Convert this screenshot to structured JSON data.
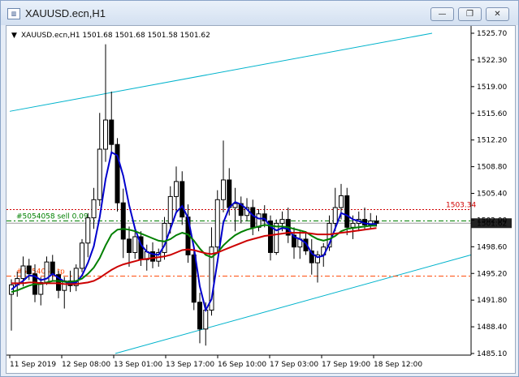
{
  "window": {
    "title": "XAUUSD.ecn,H1",
    "minimize_glyph": "—",
    "restore_glyph": "❐",
    "close_glyph": "✕"
  },
  "chart_info": {
    "header": "XAUUSD.ecn,H1  1501.68 1501.68 1501.58 1501.62"
  },
  "chart_data": {
    "type": "candlestick",
    "symbol": "XAUUSD.ecn",
    "timeframe": "H1",
    "ohlc_header": [
      1501.68,
      1501.68,
      1501.58,
      1501.62
    ],
    "y_ticks": [
      "1525.70",
      "1522.30",
      "1519.00",
      "1515.60",
      "1512.20",
      "1508.80",
      "1505.40",
      "1502.00",
      "1498.60",
      "1495.20",
      "1491.80",
      "1488.40",
      "1485.10"
    ],
    "x_ticks": [
      "11 Sep 2019",
      "12 Sep 08:00",
      "13 Sep 01:00",
      "13 Sep 17:00",
      "16 Sep 10:00",
      "17 Sep 03:00",
      "17 Sep 19:00",
      "18 Sep 12:00"
    ],
    "ylim": [
      1485.1,
      1525.7
    ],
    "current_price": "1501.62",
    "order_levels": [
      {
        "label": "#5054058 sell 0.09",
        "price": 1501.9,
        "color": "#008000"
      },
      {
        "label": "#5054058 tp",
        "price": 1494.9,
        "color": "#ff4500"
      }
    ],
    "stop_line": {
      "label": "1503.34",
      "price": 1503.34,
      "color": "#d00000"
    },
    "candles": [
      {
        "o": 1492.6,
        "h": 1494.5,
        "l": 1488.0,
        "c": 1493.8
      },
      {
        "o": 1493.8,
        "h": 1495.5,
        "l": 1492.3,
        "c": 1494.6
      },
      {
        "o": 1494.6,
        "h": 1497.4,
        "l": 1493.6,
        "c": 1496.2
      },
      {
        "o": 1496.2,
        "h": 1497.1,
        "l": 1494.4,
        "c": 1495.2
      },
      {
        "o": 1495.2,
        "h": 1496.4,
        "l": 1491.6,
        "c": 1492.6
      },
      {
        "o": 1492.6,
        "h": 1494.8,
        "l": 1491.2,
        "c": 1494.1
      },
      {
        "o": 1494.1,
        "h": 1497.4,
        "l": 1493.8,
        "c": 1496.7
      },
      {
        "o": 1496.7,
        "h": 1497.6,
        "l": 1494.4,
        "c": 1495.1
      },
      {
        "o": 1495.1,
        "h": 1495.6,
        "l": 1492.1,
        "c": 1493.1
      },
      {
        "o": 1493.1,
        "h": 1494.8,
        "l": 1490.8,
        "c": 1494.3
      },
      {
        "o": 1494.3,
        "h": 1495.6,
        "l": 1492.9,
        "c": 1493.7
      },
      {
        "o": 1493.7,
        "h": 1496.4,
        "l": 1493.0,
        "c": 1495.9
      },
      {
        "o": 1495.9,
        "h": 1499.6,
        "l": 1495.4,
        "c": 1499.1
      },
      {
        "o": 1499.1,
        "h": 1502.9,
        "l": 1497.3,
        "c": 1502.3
      },
      {
        "o": 1502.3,
        "h": 1506.1,
        "l": 1500.9,
        "c": 1504.6
      },
      {
        "o": 1504.6,
        "h": 1515.6,
        "l": 1503.8,
        "c": 1511.0
      },
      {
        "o": 1511.0,
        "h": 1524.3,
        "l": 1509.4,
        "c": 1514.7
      },
      {
        "o": 1514.7,
        "h": 1518.3,
        "l": 1510.4,
        "c": 1511.6
      },
      {
        "o": 1511.6,
        "h": 1512.4,
        "l": 1503.1,
        "c": 1504.2
      },
      {
        "o": 1504.2,
        "h": 1506.0,
        "l": 1497.2,
        "c": 1499.6
      },
      {
        "o": 1499.6,
        "h": 1501.2,
        "l": 1496.1,
        "c": 1497.9
      },
      {
        "o": 1497.9,
        "h": 1500.8,
        "l": 1497.1,
        "c": 1499.9
      },
      {
        "o": 1499.9,
        "h": 1500.6,
        "l": 1496.2,
        "c": 1497.0
      },
      {
        "o": 1497.0,
        "h": 1498.9,
        "l": 1495.6,
        "c": 1498.0
      },
      {
        "o": 1498.0,
        "h": 1499.2,
        "l": 1495.9,
        "c": 1496.8
      },
      {
        "o": 1496.8,
        "h": 1498.4,
        "l": 1496.1,
        "c": 1497.9
      },
      {
        "o": 1497.9,
        "h": 1502.4,
        "l": 1497.0,
        "c": 1501.6
      },
      {
        "o": 1501.6,
        "h": 1506.3,
        "l": 1500.3,
        "c": 1505.0
      },
      {
        "o": 1505.0,
        "h": 1508.8,
        "l": 1503.1,
        "c": 1506.9
      },
      {
        "o": 1506.9,
        "h": 1508.2,
        "l": 1501.4,
        "c": 1502.4
      },
      {
        "o": 1502.4,
        "h": 1504.0,
        "l": 1496.6,
        "c": 1497.6
      },
      {
        "o": 1497.6,
        "h": 1498.6,
        "l": 1490.6,
        "c": 1491.6
      },
      {
        "o": 1491.6,
        "h": 1492.8,
        "l": 1486.4,
        "c": 1488.2
      },
      {
        "o": 1488.2,
        "h": 1491.6,
        "l": 1486.1,
        "c": 1490.6
      },
      {
        "o": 1490.6,
        "h": 1501.1,
        "l": 1489.9,
        "c": 1498.6
      },
      {
        "o": 1498.6,
        "h": 1505.8,
        "l": 1497.8,
        "c": 1504.6
      },
      {
        "o": 1504.6,
        "h": 1512.1,
        "l": 1503.0,
        "c": 1507.1
      },
      {
        "o": 1507.1,
        "h": 1508.6,
        "l": 1502.6,
        "c": 1503.6
      },
      {
        "o": 1503.6,
        "h": 1506.1,
        "l": 1500.6,
        "c": 1504.1
      },
      {
        "o": 1504.1,
        "h": 1505.0,
        "l": 1501.6,
        "c": 1502.6
      },
      {
        "o": 1502.6,
        "h": 1504.8,
        "l": 1501.9,
        "c": 1503.6
      },
      {
        "o": 1503.6,
        "h": 1504.6,
        "l": 1500.1,
        "c": 1501.1
      },
      {
        "o": 1501.1,
        "h": 1503.4,
        "l": 1500.6,
        "c": 1502.8
      },
      {
        "o": 1502.8,
        "h": 1503.9,
        "l": 1501.1,
        "c": 1501.9
      },
      {
        "o": 1501.9,
        "h": 1502.6,
        "l": 1496.9,
        "c": 1497.9
      },
      {
        "o": 1497.9,
        "h": 1502.1,
        "l": 1497.6,
        "c": 1501.6
      },
      {
        "o": 1501.6,
        "h": 1503.1,
        "l": 1500.6,
        "c": 1502.1
      },
      {
        "o": 1502.1,
        "h": 1503.6,
        "l": 1499.1,
        "c": 1500.1
      },
      {
        "o": 1500.1,
        "h": 1501.1,
        "l": 1497.1,
        "c": 1498.6
      },
      {
        "o": 1498.6,
        "h": 1500.6,
        "l": 1497.1,
        "c": 1499.6
      },
      {
        "o": 1499.6,
        "h": 1500.6,
        "l": 1497.6,
        "c": 1498.1
      },
      {
        "o": 1498.1,
        "h": 1499.6,
        "l": 1495.1,
        "c": 1496.6
      },
      {
        "o": 1496.6,
        "h": 1498.1,
        "l": 1494.1,
        "c": 1497.6
      },
      {
        "o": 1497.6,
        "h": 1499.1,
        "l": 1496.1,
        "c": 1498.6
      },
      {
        "o": 1498.6,
        "h": 1502.6,
        "l": 1498.1,
        "c": 1501.6
      },
      {
        "o": 1501.6,
        "h": 1506.1,
        "l": 1500.6,
        "c": 1503.6
      },
      {
        "o": 1503.6,
        "h": 1506.6,
        "l": 1502.1,
        "c": 1505.1
      },
      {
        "o": 1505.1,
        "h": 1506.1,
        "l": 1500.1,
        "c": 1501.1
      },
      {
        "o": 1501.1,
        "h": 1502.6,
        "l": 1499.6,
        "c": 1501.6
      },
      {
        "o": 1501.6,
        "h": 1503.1,
        "l": 1500.6,
        "c": 1502.1
      },
      {
        "o": 1502.1,
        "h": 1503.6,
        "l": 1500.9,
        "c": 1501.4
      },
      {
        "o": 1501.4,
        "h": 1502.9,
        "l": 1500.9,
        "c": 1501.9
      },
      {
        "o": 1501.9,
        "h": 1502.6,
        "l": 1501.2,
        "c": 1501.6
      }
    ],
    "moving_averages": [
      {
        "name": "ma-fast",
        "color": "#0000cc",
        "values": [
          1493.2,
          1493.8,
          1494.3,
          1495.0,
          1494.9,
          1494.4,
          1494.6,
          1495.2,
          1494.7,
          1494.2,
          1494.0,
          1494.1,
          1495.0,
          1496.6,
          1498.7,
          1502.4,
          1507.2,
          1510.6,
          1510.2,
          1507.6,
          1503.9,
          1500.9,
          1498.9,
          1498.0,
          1497.7,
          1497.6,
          1498.8,
          1500.9,
          1503.0,
          1503.8,
          1502.3,
          1498.5,
          1493.6,
          1490.6,
          1492.0,
          1496.8,
          1501.7,
          1503.6,
          1504.3,
          1504.0,
          1503.4,
          1502.6,
          1502.2,
          1502.2,
          1501.2,
          1500.7,
          1501.0,
          1500.9,
          1499.9,
          1499.6,
          1499.1,
          1497.8,
          1497.3,
          1497.5,
          1499.0,
          1501.0,
          1502.9,
          1502.6,
          1502.1,
          1501.9,
          1501.6,
          1501.5,
          1501.5
        ]
      },
      {
        "name": "ma-mid",
        "color": "#008000",
        "values": [
          1492.9,
          1493.1,
          1493.4,
          1493.7,
          1493.9,
          1493.9,
          1494.1,
          1494.3,
          1494.3,
          1494.2,
          1494.2,
          1494.3,
          1494.6,
          1495.2,
          1496.0,
          1497.2,
          1498.8,
          1500.2,
          1500.8,
          1500.9,
          1500.8,
          1500.6,
          1500.3,
          1500.0,
          1499.7,
          1499.4,
          1499.3,
          1499.6,
          1500.1,
          1500.4,
          1500.2,
          1499.4,
          1498.4,
          1497.6,
          1497.3,
          1497.9,
          1498.8,
          1499.5,
          1500.1,
          1500.5,
          1500.8,
          1501.0,
          1501.2,
          1501.4,
          1501.3,
          1501.2,
          1501.2,
          1501.1,
          1500.9,
          1500.7,
          1500.5,
          1500.0,
          1499.6,
          1499.4,
          1499.6,
          1500.0,
          1500.6,
          1500.9,
          1501.0,
          1501.1,
          1501.2,
          1501.3,
          1501.3
        ]
      },
      {
        "name": "ma-slow",
        "color": "#cc0000",
        "values": [
          1494.0,
          1494.0,
          1494.0,
          1494.1,
          1494.1,
          1494.0,
          1494.0,
          1494.0,
          1494.0,
          1493.9,
          1493.9,
          1493.9,
          1494.0,
          1494.1,
          1494.3,
          1494.7,
          1495.2,
          1495.7,
          1496.1,
          1496.4,
          1496.6,
          1496.8,
          1497.0,
          1497.1,
          1497.2,
          1497.3,
          1497.4,
          1497.6,
          1497.9,
          1498.2,
          1498.3,
          1498.2,
          1498.0,
          1497.8,
          1497.7,
          1497.9,
          1498.2,
          1498.5,
          1498.8,
          1499.1,
          1499.4,
          1499.6,
          1499.8,
          1500.0,
          1500.1,
          1500.2,
          1500.3,
          1500.4,
          1500.4,
          1500.4,
          1500.4,
          1500.3,
          1500.2,
          1500.2,
          1500.2,
          1500.3,
          1500.4,
          1500.5,
          1500.6,
          1500.7,
          1500.8,
          1500.9,
          1501.0
        ]
      }
    ],
    "channel_lines": [
      {
        "name": "upper-channel",
        "color": "#00b3cc",
        "from": {
          "x": 0,
          "y": 1515.8
        },
        "to": {
          "x": 520,
          "y": 1525.7
        }
      },
      {
        "name": "lower-channel",
        "color": "#00b3cc",
        "from": {
          "x": 130,
          "y": 1485.1
        },
        "to": {
          "x": 568,
          "y": 1497.6
        }
      }
    ]
  }
}
